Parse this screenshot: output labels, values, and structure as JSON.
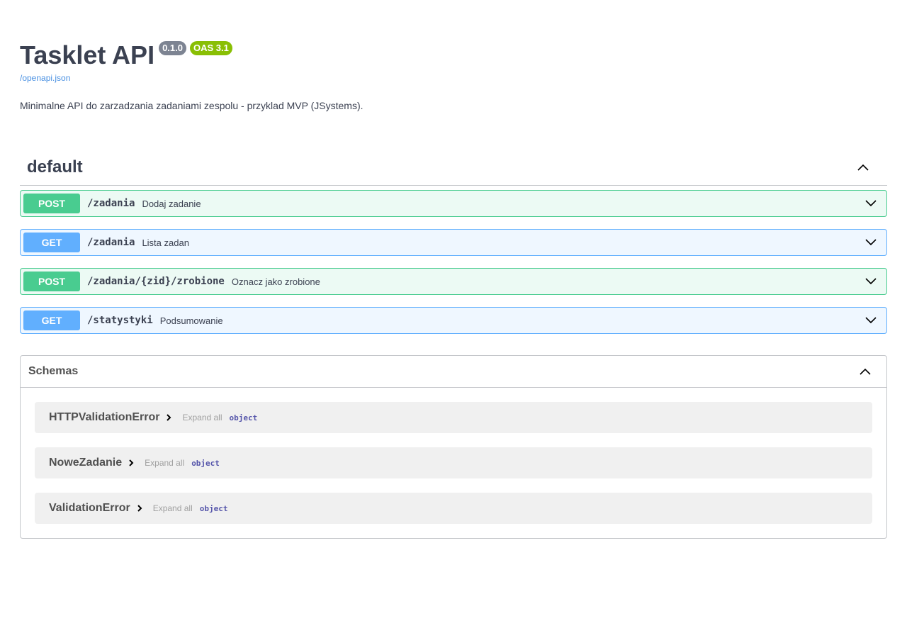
{
  "info": {
    "title": "Tasklet API",
    "version_badge": "0.1.0",
    "oas_badge": "OAS 3.1",
    "spec_link": "/openapi.json",
    "description": "Minimalne API do zarzadzania zadaniami zespolu - przyklad MVP (JSystems)."
  },
  "tag": {
    "name": "default",
    "toggle_icon": "chevron-up-icon",
    "operations": [
      {
        "method": "POST",
        "path": "/zadania",
        "summary": "Dodaj zadanie"
      },
      {
        "method": "GET",
        "path": "/zadania",
        "summary": "Lista zadan"
      },
      {
        "method": "POST",
        "path": "/zadania/{zid}/zrobione",
        "summary": "Oznacz jako zrobione"
      },
      {
        "method": "GET",
        "path": "/statystyki",
        "summary": "Podsumowanie"
      }
    ]
  },
  "schemas": {
    "title": "Schemas",
    "toggle_icon": "chevron-up-icon",
    "items": [
      {
        "name": "HTTPValidationError",
        "expand_label": "Expand all",
        "type": "object"
      },
      {
        "name": "NoweZadanie",
        "expand_label": "Expand all",
        "type": "object"
      },
      {
        "name": "ValidationError",
        "expand_label": "Expand all",
        "type": "object"
      }
    ]
  },
  "colors": {
    "post": "#49cc90",
    "get": "#61affe",
    "version_badge": "#7d8492",
    "oas_badge": "#89bf04",
    "link": "#4990e2",
    "text": "#3b4151"
  }
}
